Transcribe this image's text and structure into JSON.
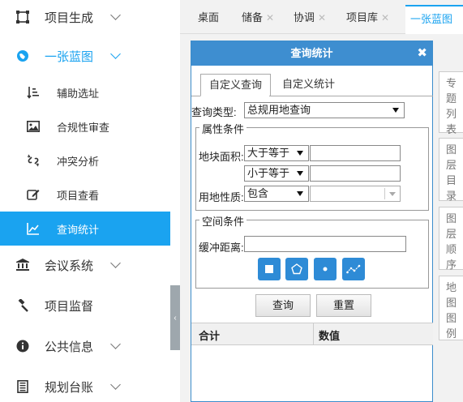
{
  "sidebar": {
    "items": [
      {
        "label": "项目生成",
        "icon": "scan-frame-icon"
      },
      {
        "label": "一张蓝图",
        "icon": "globe-icon"
      },
      {
        "label": "会议系统",
        "icon": "bank-icon"
      },
      {
        "label": "项目监督",
        "icon": "gavel-icon"
      },
      {
        "label": "公共信息",
        "icon": "info-icon"
      },
      {
        "label": "规划台账",
        "icon": "ledger-icon"
      }
    ],
    "sub_items": [
      {
        "label": "辅助选址",
        "icon": "sort-list-icon"
      },
      {
        "label": "合规性审查",
        "icon": "image-icon"
      },
      {
        "label": "冲突分析",
        "icon": "broken-link-icon"
      },
      {
        "label": "项目查看",
        "icon": "edit-icon"
      },
      {
        "label": "查询统计",
        "icon": "line-chart-icon"
      }
    ],
    "active_sub": "查询统计",
    "accent_color": "#1aa3f0"
  },
  "tabs": [
    {
      "label": "桌面",
      "closable": false
    },
    {
      "label": "储备",
      "closable": true
    },
    {
      "label": "协调",
      "closable": true
    },
    {
      "label": "项目库",
      "closable": true
    },
    {
      "label": "一张蓝图",
      "closable": true
    }
  ],
  "side_tabs": [
    "专题列表",
    "图层目录",
    "图层顺序",
    "地图图例"
  ],
  "dialog": {
    "title": "查询统计",
    "close": "✖",
    "tabs": [
      "自定义查询",
      "自定义统计"
    ],
    "query_type_label": "查询类型:",
    "query_type_value": "总规用地查询",
    "attr_group": "属性条件",
    "area_label": "地块面积:",
    "op1": "大于等于",
    "op2": "小于等于",
    "landuse_label": "用地性质:",
    "landuse_op": "包含",
    "spatial_group": "空间条件",
    "buffer_label": "缓冲距离:",
    "query_button": "查询",
    "reset_button": "重置",
    "columns": [
      "合计",
      "数值"
    ]
  }
}
